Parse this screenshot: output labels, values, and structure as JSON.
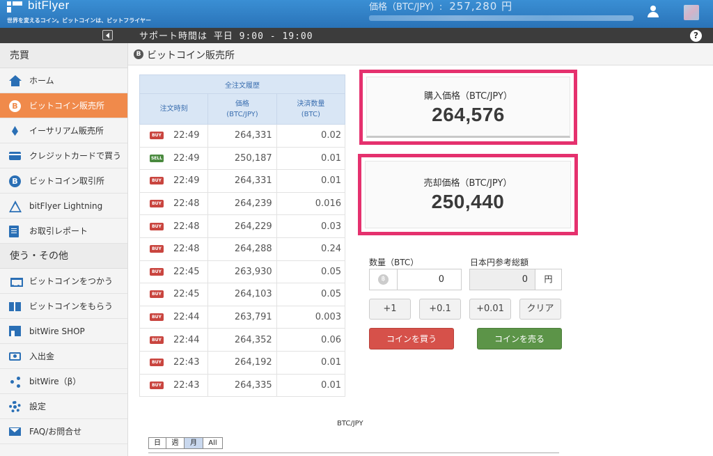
{
  "header": {
    "logo_name": "bitFlyer",
    "tagline": "世界を変えるコイン。ビットコインは、ビットフライヤー",
    "price_label": "価格（BTC/JPY）:",
    "price_value": "257,280 円"
  },
  "infobar": {
    "support_hours": "サポート時間は 平日 9:00 - 19:00",
    "help": "?"
  },
  "sidebar": {
    "section_trade": "売買",
    "section_other": "使う・その他",
    "trade_items": [
      {
        "label": "ホーム",
        "icon": "home-icon"
      },
      {
        "label": "ビットコイン販売所",
        "icon": "bitcoin-icon",
        "active": true
      },
      {
        "label": "イーサリアム販売所",
        "icon": "ethereum-icon"
      },
      {
        "label": "クレジットカードで買う",
        "icon": "credit-card-icon"
      },
      {
        "label": "ビットコイン取引所",
        "icon": "bitcoin-icon"
      },
      {
        "label": "bitFlyer Lightning",
        "icon": "lightning-icon"
      },
      {
        "label": "お取引レポート",
        "icon": "report-icon"
      }
    ],
    "other_items": [
      {
        "label": "ビットコインをつかう",
        "icon": "cart-icon"
      },
      {
        "label": "ビットコインをもらう",
        "icon": "gift-icon"
      },
      {
        "label": "bitWire SHOP",
        "icon": "shop-icon"
      },
      {
        "label": "入出金",
        "icon": "money-icon"
      },
      {
        "label": "bitWire（β）",
        "icon": "share-icon"
      },
      {
        "label": "設定",
        "icon": "gear-icon"
      },
      {
        "label": "FAQ/お問合せ",
        "icon": "mail-icon"
      }
    ]
  },
  "page": {
    "title": "ビットコイン販売所",
    "coin_glyph": "B"
  },
  "orders": {
    "caption": "全注文履歴",
    "col_time": "注文時刻",
    "col_price_1": "価格",
    "col_price_2": "(BTC/JPY)",
    "col_qty_1": "決済数量",
    "col_qty_2": "(BTC)",
    "rows": [
      {
        "side": "BUY",
        "time": "22:49",
        "price": "264,331",
        "qty": "0.02"
      },
      {
        "side": "SELL",
        "time": "22:49",
        "price": "250,187",
        "qty": "0.01"
      },
      {
        "side": "BUY",
        "time": "22:49",
        "price": "264,331",
        "qty": "0.01"
      },
      {
        "side": "BUY",
        "time": "22:48",
        "price": "264,239",
        "qty": "0.016"
      },
      {
        "side": "BUY",
        "time": "22:48",
        "price": "264,229",
        "qty": "0.03"
      },
      {
        "side": "BUY",
        "time": "22:48",
        "price": "264,288",
        "qty": "0.24"
      },
      {
        "side": "BUY",
        "time": "22:45",
        "price": "263,930",
        "qty": "0.05"
      },
      {
        "side": "BUY",
        "time": "22:45",
        "price": "264,103",
        "qty": "0.05"
      },
      {
        "side": "BUY",
        "time": "22:44",
        "price": "263,791",
        "qty": "0.003"
      },
      {
        "side": "BUY",
        "time": "22:44",
        "price": "264,352",
        "qty": "0.06"
      },
      {
        "side": "BUY",
        "time": "22:43",
        "price": "264,192",
        "qty": "0.01"
      },
      {
        "side": "BUY",
        "time": "22:43",
        "price": "264,335",
        "qty": "0.01"
      }
    ],
    "badge_colors": {
      "BUY": "#c9453f",
      "SELL": "#4a8a3f"
    }
  },
  "prices": {
    "buy_label": "購入価格（BTC/JPY）",
    "buy_value": "264,576",
    "sell_label": "売却価格（BTC/JPY）",
    "sell_value": "250,440",
    "highlight_color": "#e5316e"
  },
  "form": {
    "qty_label": "数量（BTC）",
    "qty_value": "0",
    "yen_label": "日本円参考総額",
    "yen_value": "0",
    "yen_unit": "円",
    "steps": [
      "+1",
      "+0.1",
      "+0.01",
      "クリア"
    ],
    "buy_button": "コインを買う",
    "sell_button": "コインを売る"
  },
  "chart": {
    "title": "BTC/JPY",
    "ranges": [
      "日",
      "週",
      "月",
      "All"
    ],
    "selected_range": "月"
  }
}
